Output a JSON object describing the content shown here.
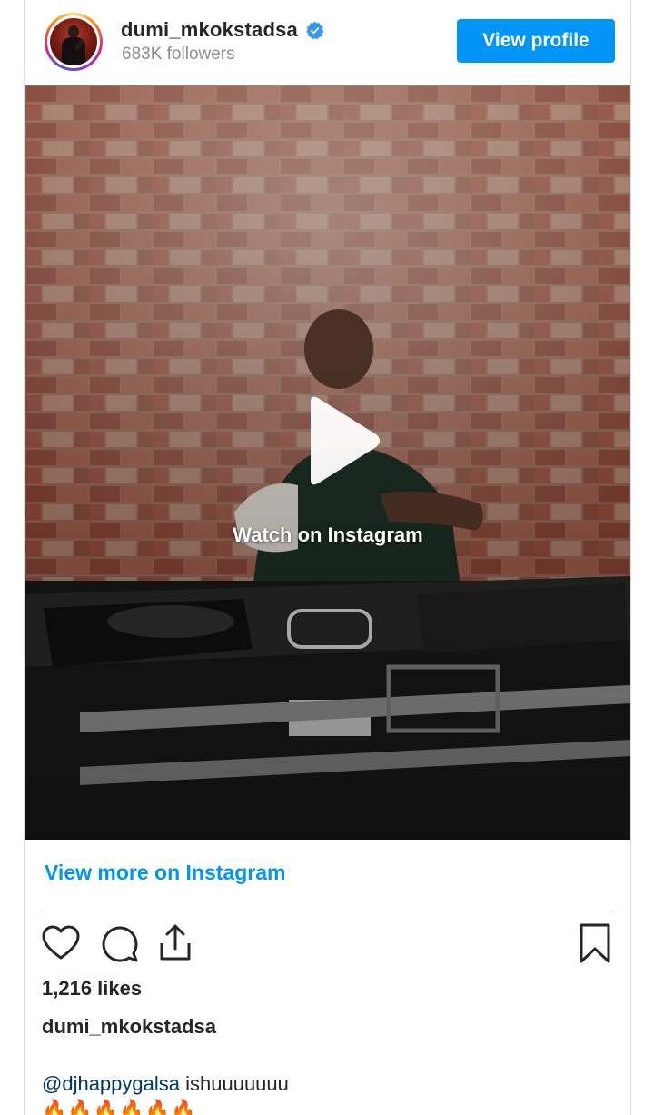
{
  "header": {
    "username": "dumi_mkokstadsa",
    "followers": "683K followers",
    "view_profile_label": "View profile"
  },
  "media": {
    "watch_label": "Watch on Instagram"
  },
  "view_more_label": "View more on Instagram",
  "post": {
    "likes": "1,216 likes",
    "caption_username": "dumi_mkokstadsa",
    "mention": "@djhappygalsa",
    "caption_text": " ishuuuuuuu",
    "emojis": "🔥🔥🔥🔥🔥🔥"
  },
  "colors": {
    "accent": "#0095f6",
    "link_dark": "#00376b",
    "muted": "#8e8e8e",
    "text": "#262626"
  },
  "icons": [
    "verified-badge-icon",
    "play-icon",
    "heart-icon",
    "comment-icon",
    "share-icon",
    "bookmark-icon"
  ]
}
